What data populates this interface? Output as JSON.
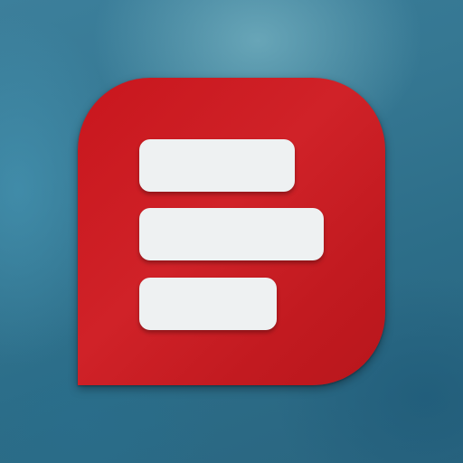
{
  "background": {
    "colors": [
      "#3c7f9b",
      "#2a6580"
    ]
  },
  "app_icon": {
    "icon": "menu-lines-icon",
    "fill_color": "#c8161d",
    "bar_color": "#eef1f2",
    "bar_count": 3
  }
}
